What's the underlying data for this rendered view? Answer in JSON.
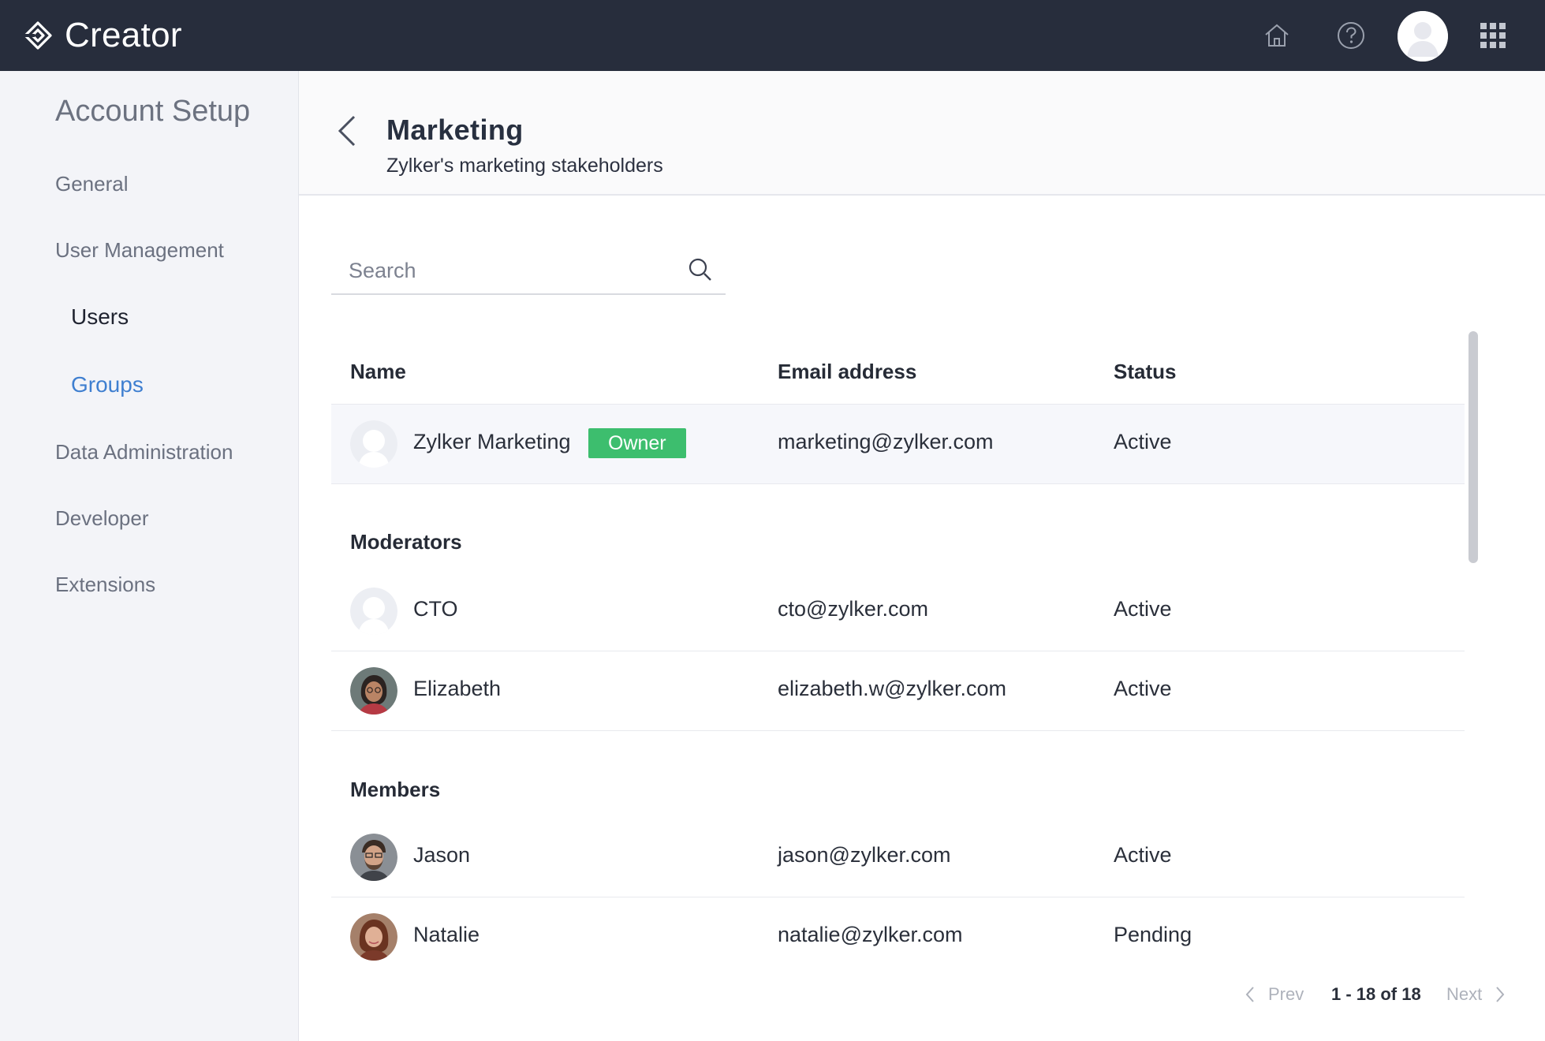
{
  "app": {
    "name": "Creator"
  },
  "topbar": {
    "icons": [
      "home-icon",
      "help-icon",
      "user-avatar",
      "apps-grid-icon"
    ]
  },
  "sidebar": {
    "title": "Account Setup",
    "items": [
      {
        "label": "General"
      },
      {
        "label": "User Management"
      },
      {
        "label": "Users"
      },
      {
        "label": "Groups"
      },
      {
        "label": "Data Administration"
      },
      {
        "label": "Developer"
      },
      {
        "label": "Extensions"
      }
    ],
    "active_item": "Groups"
  },
  "group": {
    "title": "Marketing",
    "description": "Zylker's marketing stakeholders"
  },
  "search": {
    "placeholder": "Search",
    "value": ""
  },
  "table": {
    "headers": {
      "name": "Name",
      "email": "Email address",
      "status": "Status"
    },
    "owner": {
      "name": "Zylker Marketing",
      "badge": "Owner",
      "email": "marketing@zylker.com",
      "status": "Active"
    },
    "sections": [
      {
        "label": "Moderators",
        "rows": [
          {
            "name": "CTO",
            "email": "cto@zylker.com",
            "status": "Active"
          },
          {
            "name": "Elizabeth",
            "email": "elizabeth.w@zylker.com",
            "status": "Active"
          }
        ]
      },
      {
        "label": "Members",
        "rows": [
          {
            "name": "Jason",
            "email": "jason@zylker.com",
            "status": "Active"
          },
          {
            "name": "Natalie",
            "email": "natalie@zylker.com",
            "status": "Pending"
          }
        ]
      }
    ]
  },
  "pagination": {
    "prev": "Prev",
    "info": "1 - 18 of 18",
    "next": "Next"
  },
  "colors": {
    "topbar": "#272d3c",
    "accent_link": "#3f7fd0",
    "owner_badge": "#3dbe6e",
    "sidebar_bg": "#f3f4f8"
  }
}
